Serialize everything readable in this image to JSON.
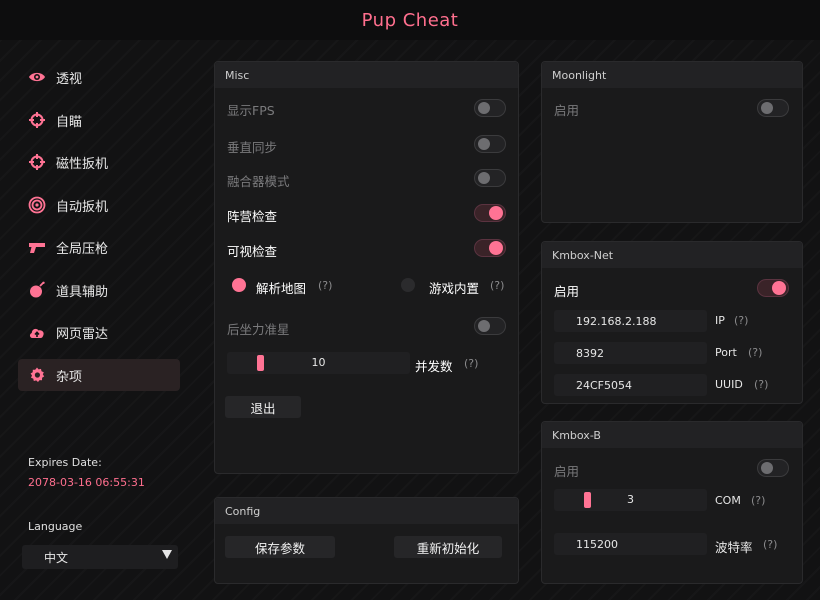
{
  "app": {
    "title": "Pup Cheat",
    "accent": "#ff7394"
  },
  "sidebar": {
    "items": [
      {
        "label": "透视",
        "icon": "eye-icon"
      },
      {
        "label": "自瞄",
        "icon": "crosshair-icon"
      },
      {
        "label": "磁性扳机",
        "icon": "crosshair-icon"
      },
      {
        "label": "自动扳机",
        "icon": "target-icon"
      },
      {
        "label": "全局压枪",
        "icon": "gun-icon"
      },
      {
        "label": "道具辅助",
        "icon": "bomb-icon"
      },
      {
        "label": "网页雷达",
        "icon": "cloud-upload-icon"
      },
      {
        "label": "杂项",
        "icon": "gear-icon",
        "active": true
      }
    ],
    "expires_label": "Expires Date:",
    "expires_value": "2078-03-16 06:55:31",
    "language_label": "Language",
    "language_value": "中文"
  },
  "misc": {
    "header": "Misc",
    "show_fps": {
      "label": "显示FPS",
      "on": false
    },
    "vsync": {
      "label": "垂直同步",
      "on": false
    },
    "fuser_mode": {
      "label": "融合器模式",
      "on": false
    },
    "team_check": {
      "label": "阵营检查",
      "on": true
    },
    "visible_check": {
      "label": "可视检查",
      "on": true
    },
    "parse_map": {
      "label": "解析地图",
      "help": "(?)",
      "selected": true
    },
    "game_builtin": {
      "label": "游戏内置",
      "help": "(?)",
      "selected": false
    },
    "recoil_crosshair": {
      "label": "后坐力准星",
      "on": false
    },
    "burst": {
      "value": "10",
      "label": "并发数",
      "help": "(?)",
      "fraction": 0.0
    },
    "exit_label": "退出"
  },
  "config": {
    "header": "Config",
    "save_label": "保存参数",
    "reinit_label": "重新初始化"
  },
  "moonlight": {
    "header": "Moonlight",
    "enable": {
      "label": "启用",
      "on": false
    }
  },
  "kmbox_net": {
    "header": "Kmbox-Net",
    "enable": {
      "label": "启用",
      "on": true
    },
    "ip": {
      "value": "192.168.2.188",
      "label": "IP",
      "help": "(?)"
    },
    "port": {
      "value": "8392",
      "label": "Port",
      "help": "(?)"
    },
    "uuid": {
      "value": "24CF5054",
      "label": "UUID",
      "help": "(?)"
    }
  },
  "kmbox_b": {
    "header": "Kmbox-B",
    "enable": {
      "label": "启用",
      "on": false
    },
    "com": {
      "value": "3",
      "label": "COM",
      "help": "(?)",
      "fraction": 0.0
    },
    "baud": {
      "value": "115200",
      "label": "波特率",
      "help": "(?)"
    }
  }
}
